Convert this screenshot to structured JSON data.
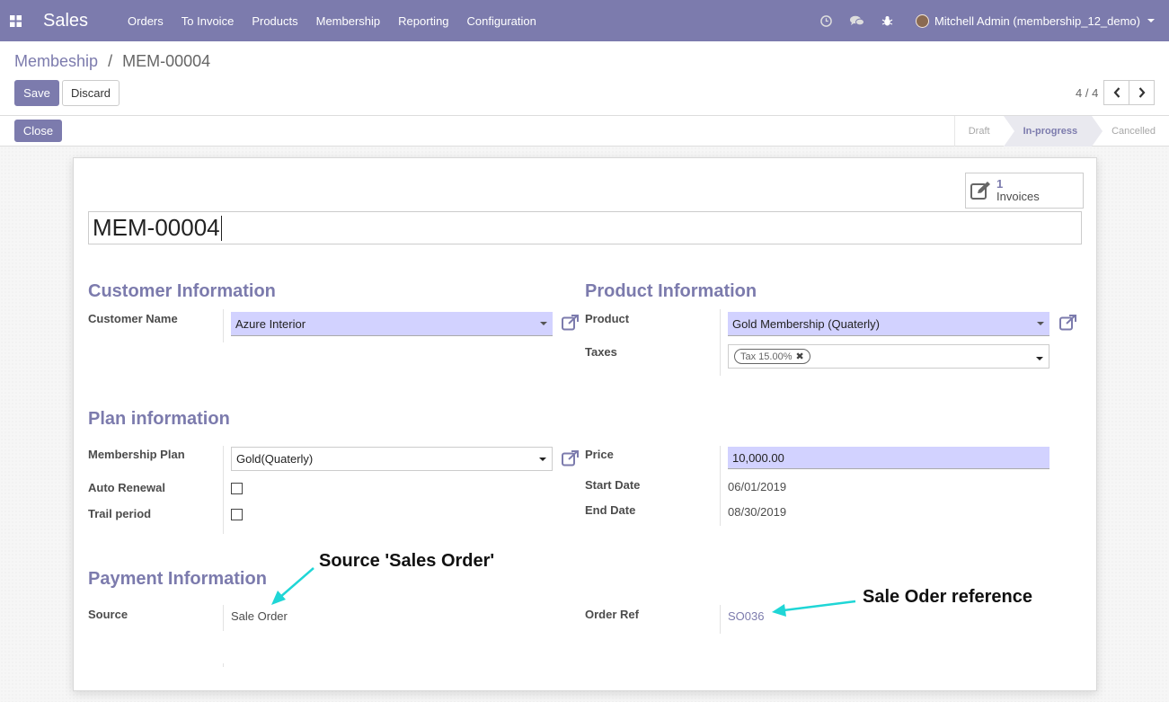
{
  "navbar": {
    "brand": "Sales",
    "menu": [
      "Orders",
      "To Invoice",
      "Products",
      "Membership",
      "Reporting",
      "Configuration"
    ],
    "user": "Mitchell Admin (membership_12_demo)",
    "icons": [
      "apps-icon",
      "clock-icon",
      "chat-icon",
      "bug-icon"
    ]
  },
  "breadcrumb": {
    "parent": "Membeship",
    "separator": "/",
    "current": "MEM-00004"
  },
  "actions": {
    "save": "Save",
    "discard": "Discard",
    "close": "Close"
  },
  "pager": {
    "value": "4 / 4"
  },
  "statusbar": {
    "steps": [
      "Draft",
      "In-progress",
      "Cancelled"
    ],
    "active": "In-progress"
  },
  "smart_button": {
    "count": "1",
    "label": "Invoices"
  },
  "record": {
    "name": "MEM-00004",
    "customer_section": "Customer Information",
    "product_section": "Product Information",
    "plan_section": "Plan information",
    "payment_section": "Payment Information",
    "customer_name_label": "Customer Name",
    "customer_name": "Azure Interior",
    "product_label": "Product",
    "product": "Gold Membership (Quaterly)",
    "taxes_label": "Taxes",
    "tax_tag": "Tax 15.00%",
    "membership_plan_label": "Membership Plan",
    "membership_plan": "Gold(Quaterly)",
    "auto_renewal_label": "Auto Renewal",
    "trail_period_label": "Trail period",
    "price_label": "Price",
    "price": "10,000.00",
    "start_date_label": "Start Date",
    "start_date": "06/01/2019",
    "end_date_label": "End Date",
    "end_date": "08/30/2019",
    "source_label": "Source",
    "source": "Sale Order",
    "order_ref_label": "Order Ref",
    "order_ref": "SO036"
  },
  "annotations": {
    "source_note": "Source 'Sales Order'",
    "ref_note": "Sale Oder reference",
    "arrow_color": "#1fd6d6"
  },
  "colors": {
    "brand": "#7c7bad",
    "required_field": "#d2d2ff"
  }
}
